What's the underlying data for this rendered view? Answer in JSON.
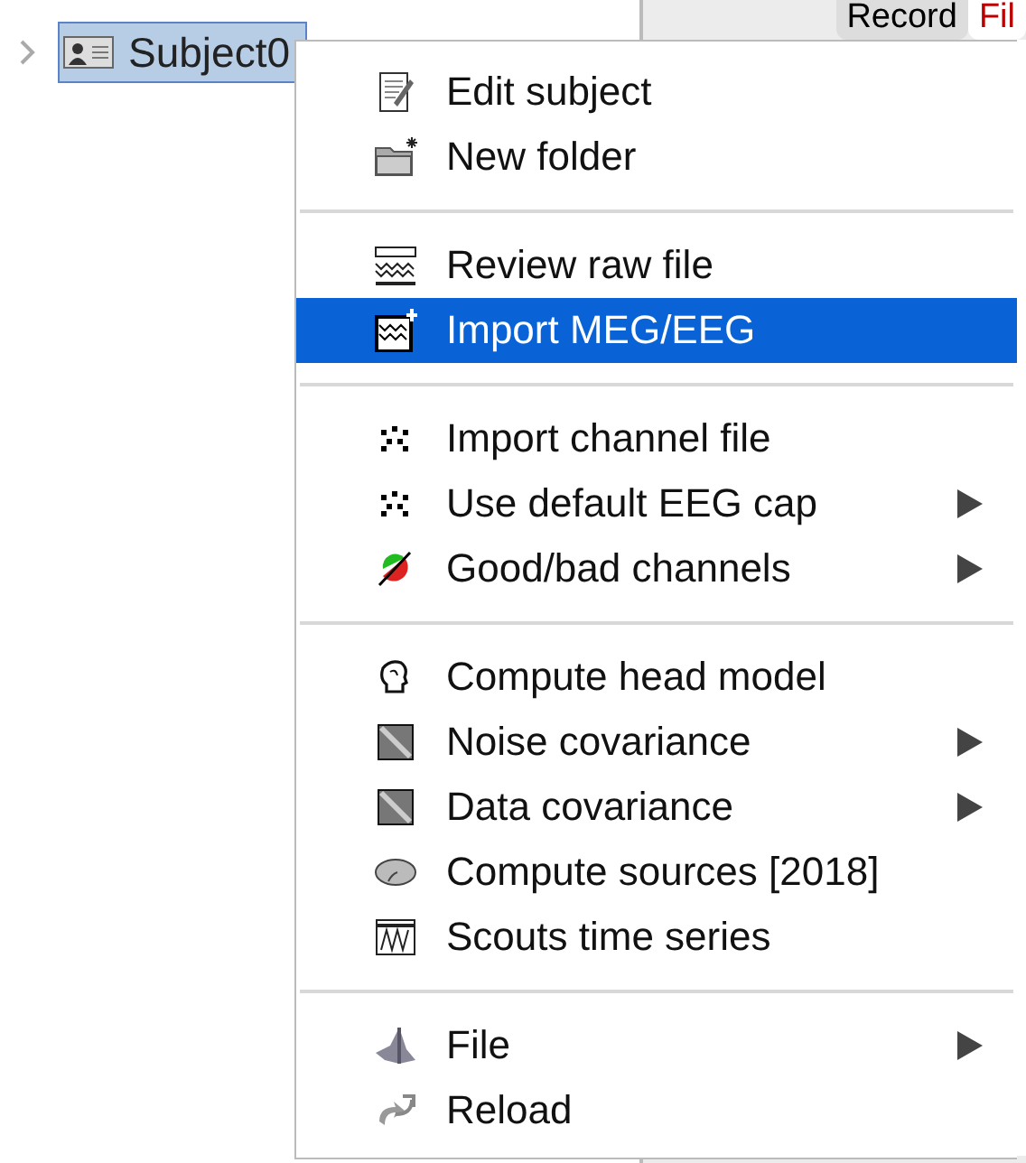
{
  "tree": {
    "items": [
      {
        "label": "Subject0",
        "selected": true
      }
    ]
  },
  "panel": {
    "tabs": [
      {
        "label": "Record",
        "selected": false
      },
      {
        "label": "Fil",
        "selected": true
      }
    ]
  },
  "context_menu": {
    "sections": [
      {
        "items": [
          {
            "label": "Edit subject",
            "selected": false,
            "submenu": false
          },
          {
            "label": "New folder",
            "selected": false,
            "submenu": false
          }
        ]
      },
      {
        "items": [
          {
            "label": "Review raw file",
            "selected": false,
            "submenu": false
          },
          {
            "label": "Import MEG/EEG",
            "selected": true,
            "submenu": false
          }
        ]
      },
      {
        "items": [
          {
            "label": "Import channel file",
            "selected": false,
            "submenu": false
          },
          {
            "label": "Use default EEG cap",
            "selected": false,
            "submenu": true
          },
          {
            "label": "Good/bad channels",
            "selected": false,
            "submenu": true
          }
        ]
      },
      {
        "items": [
          {
            "label": "Compute head model",
            "selected": false,
            "submenu": false
          },
          {
            "label": "Noise covariance",
            "selected": false,
            "submenu": true
          },
          {
            "label": "Data covariance",
            "selected": false,
            "submenu": true
          },
          {
            "label": "Compute sources [2018]",
            "selected": false,
            "submenu": false
          },
          {
            "label": "Scouts time series",
            "selected": false,
            "submenu": false
          }
        ]
      },
      {
        "items": [
          {
            "label": "File",
            "selected": false,
            "submenu": true
          },
          {
            "label": "Reload",
            "selected": false,
            "submenu": false
          }
        ]
      }
    ]
  }
}
